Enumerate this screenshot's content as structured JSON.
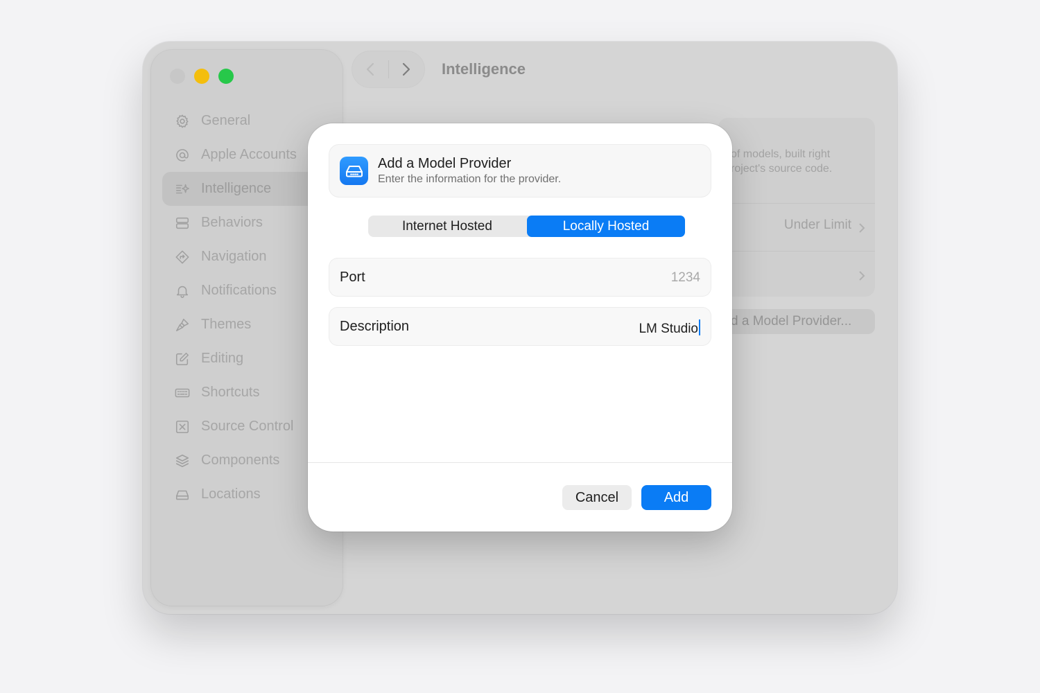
{
  "window": {
    "title": "Intelligence",
    "traffic_lights": [
      "close",
      "minimize",
      "maximize"
    ]
  },
  "sidebar": {
    "items": [
      {
        "label": "General",
        "icon": "gear-icon"
      },
      {
        "label": "Apple Accounts",
        "icon": "at-icon"
      },
      {
        "label": "Intelligence",
        "icon": "sparkle-list-icon",
        "active": true
      },
      {
        "label": "Behaviors",
        "icon": "stack-rectangles-icon"
      },
      {
        "label": "Navigation",
        "icon": "diamond-arrow-icon"
      },
      {
        "label": "Notifications",
        "icon": "bell-icon"
      },
      {
        "label": "Themes",
        "icon": "brush-icon"
      },
      {
        "label": "Editing",
        "icon": "pencil-square-icon"
      },
      {
        "label": "Shortcuts",
        "icon": "keyboard-icon"
      },
      {
        "label": "Source Control",
        "icon": "source-control-icon"
      },
      {
        "label": "Components",
        "icon": "layers-icon"
      },
      {
        "label": "Locations",
        "icon": "drive-icon"
      }
    ]
  },
  "background_card": {
    "desc_line1": "of models, built right",
    "desc_line2": "roject's source code.",
    "row1_value": "Under Limit",
    "add_button": "d a Model Provider..."
  },
  "dialog": {
    "title": "Add a Model Provider",
    "subtitle": "Enter the information for the provider.",
    "segments": [
      "Internet Hosted",
      "Locally Hosted"
    ],
    "selected_segment": "Locally Hosted",
    "port": {
      "label": "Port",
      "placeholder": "1234"
    },
    "description": {
      "label": "Description",
      "value": "LM Studio"
    },
    "cancel_label": "Cancel",
    "add_label": "Add",
    "accent_color": "#0a7cf5"
  }
}
